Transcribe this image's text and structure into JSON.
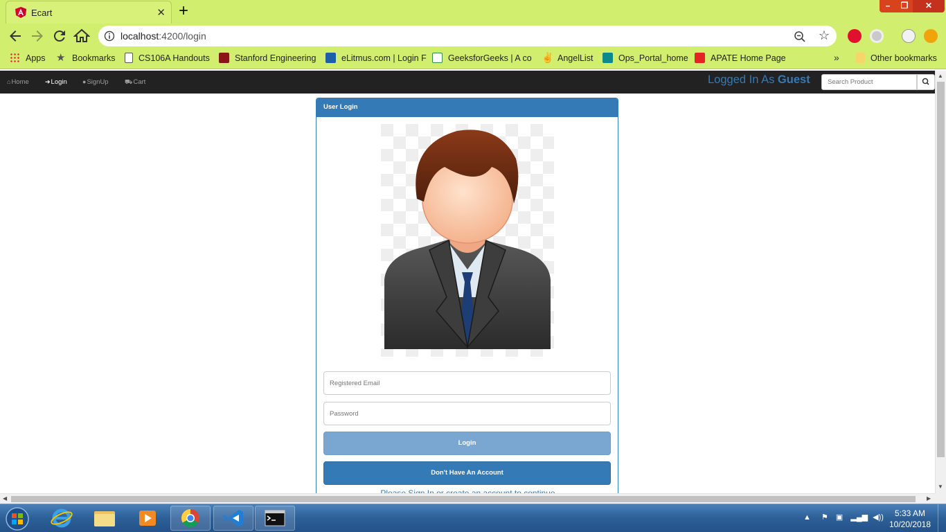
{
  "browser": {
    "tab_title": "Ecart",
    "new_tab": "+",
    "url_host": "localhost",
    "url_path": ":4200/login",
    "bookmarks": [
      {
        "label": "Apps",
        "icon": "apps-grid-icon"
      },
      {
        "label": "Bookmarks",
        "icon": "star-icon"
      },
      {
        "label": "CS106A Handouts",
        "icon": "page-icon"
      },
      {
        "label": "Stanford Engineering",
        "icon": "stanford-icon"
      },
      {
        "label": "eLitmus.com | Login F",
        "icon": "elitmus-icon"
      },
      {
        "label": "GeeksforGeeks | A co",
        "icon": "gfg-icon"
      },
      {
        "label": "AngelList",
        "icon": "angellist-icon"
      },
      {
        "label": "Ops_Portal_home",
        "icon": "sharepoint-icon"
      },
      {
        "label": "APATE Home Page",
        "icon": "apate-icon"
      }
    ],
    "bookmarks_more": "»",
    "other_bookmarks": "Other bookmarks"
  },
  "nav": {
    "home": "Home",
    "login": "Login",
    "signup": "SignUp",
    "cart": "Cart",
    "logged_prefix": "Logged In As ",
    "logged_user": "Guest",
    "search_placeholder": "Search Product"
  },
  "panel": {
    "heading": "User Login",
    "email_placeholder": "Registered Email",
    "password_placeholder": "Password",
    "login_button": "Login",
    "signup_button": "Don't Have An Account",
    "tagline": "Please Sign In or create an account to continue"
  },
  "taskbar": {
    "time": "5:33 AM",
    "date": "10/20/2018"
  },
  "colors": {
    "chrome_theme": "#d2ee6f",
    "navbar": "#222222",
    "primary": "#337ab7",
    "login_button_disabled": "#7aa7d1"
  }
}
